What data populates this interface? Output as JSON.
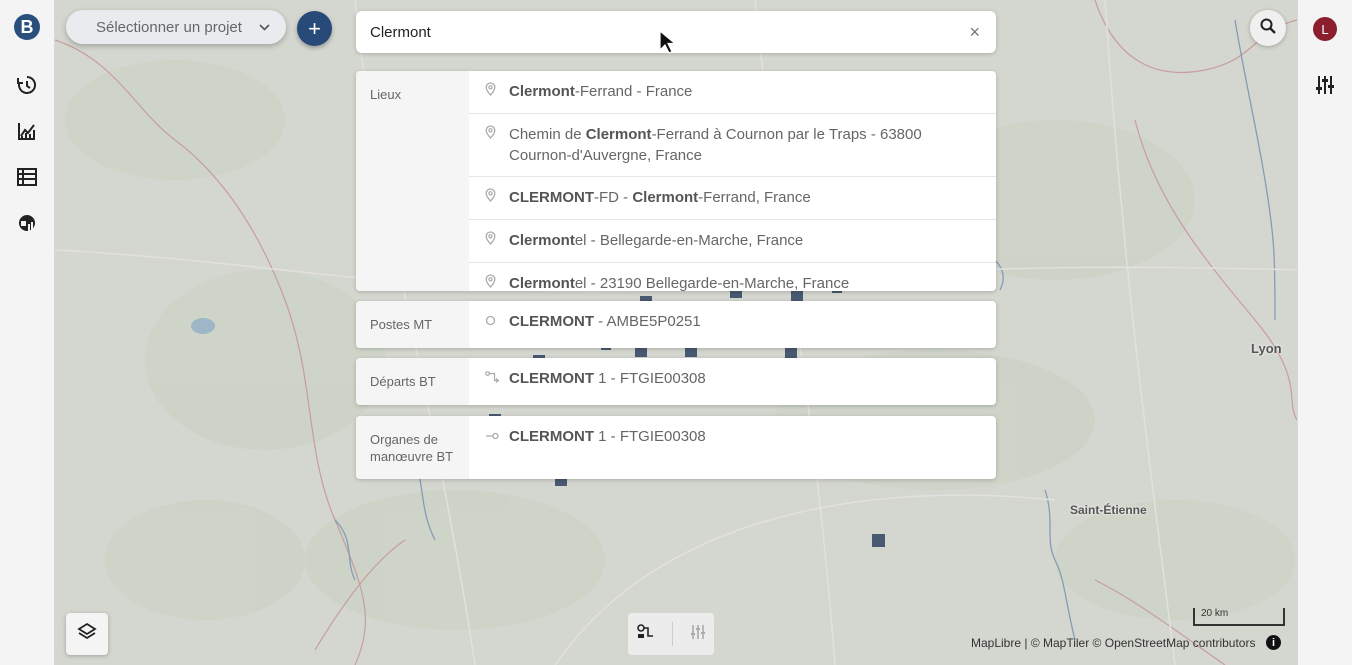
{
  "sidebar": {
    "logo_letter": "B",
    "items": [
      {
        "name": "history-icon"
      },
      {
        "name": "chart-icon"
      },
      {
        "name": "table-icon"
      },
      {
        "name": "globe-chart-icon"
      }
    ]
  },
  "user": {
    "initial": "L"
  },
  "header": {
    "project_select_label": "Sélectionner un projet",
    "add_label": "+"
  },
  "search": {
    "value": "Clermont",
    "placeholder": "",
    "clear_label": "×"
  },
  "results": {
    "lieux": {
      "label": "Lieux",
      "items": [
        {
          "parts": [
            {
              "b": "Clermont"
            },
            {
              "t": "-Ferrand - France"
            }
          ]
        },
        {
          "parts": [
            {
              "t": "Chemin de "
            },
            {
              "b": "Clermont"
            },
            {
              "t": "-Ferrand à Cournon par le Traps - 63800 Cournon-d'Auvergne, France"
            }
          ]
        },
        {
          "parts": [
            {
              "b": "CLERMONT"
            },
            {
              "t": "-FD - "
            },
            {
              "b": "Clermont"
            },
            {
              "t": "-Ferrand, France"
            }
          ]
        },
        {
          "parts": [
            {
              "b": "Clermont"
            },
            {
              "t": "el - Bellegarde-en-Marche, France"
            }
          ]
        },
        {
          "parts": [
            {
              "b": "Clermont"
            },
            {
              "t": "el - 23190 Bellegarde-en-Marche, France"
            }
          ]
        }
      ]
    },
    "postes_mt": {
      "label": "Postes MT",
      "items": [
        {
          "parts": [
            {
              "b": "CLERMONT"
            },
            {
              "t": " - AMBE5P0251"
            }
          ]
        }
      ]
    },
    "departs_bt": {
      "label": "Départs BT",
      "items": [
        {
          "parts": [
            {
              "b": "CLERMONT"
            },
            {
              "t": " 1 - FTGIE00308"
            }
          ]
        }
      ]
    },
    "organes_bt": {
      "label": "Organes de manœuvre BT",
      "items": [
        {
          "parts": [
            {
              "b": "CLERMONT"
            },
            {
              "t": " 1 - FTGIE00308"
            }
          ]
        }
      ]
    }
  },
  "map": {
    "cities": [
      {
        "name": "Lyon"
      },
      {
        "name": "Saint-Étienne"
      }
    ],
    "scale_label": "20 km",
    "attribution": "MapLibre | © MapTiler © OpenStreetMap contributors",
    "info_label": "i"
  },
  "colors": {
    "primary": "#274a78",
    "avatar": "#8b1f2e",
    "marker": "#1f3554"
  }
}
